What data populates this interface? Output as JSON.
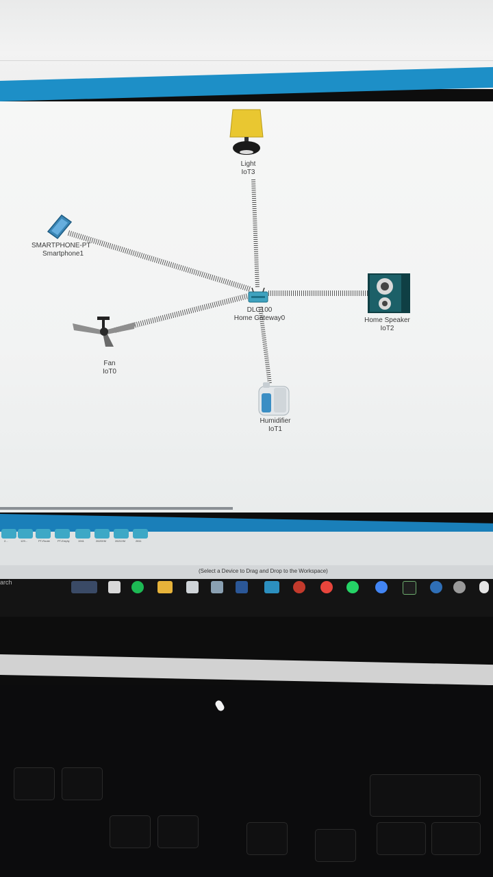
{
  "workspace": {
    "devices": [
      {
        "name": "Light",
        "id": "IoT3"
      },
      {
        "name": "SMARTPHONE-PT",
        "id": "Smartphone1"
      },
      {
        "name": "DLC100",
        "id": "Home Gateway0"
      },
      {
        "name": "Home Speaker",
        "id": "IoT2"
      },
      {
        "name": "Fan",
        "id": "IoT0"
      },
      {
        "name": "Humidifier",
        "id": "IoT1"
      }
    ]
  },
  "device_palette": {
    "labels": [
      "2...",
      "129...",
      "PT-Route",
      "PT-Empty",
      "1941",
      "2620XM",
      "2621XM",
      "2811"
    ]
  },
  "status_hint": "(Select a Device to Drag and Drop to the Workspace)",
  "taskbar": {
    "search_label": "arch"
  },
  "colors": {
    "accent_blue": "#1d8fc7",
    "workspace_bg": "#f3f4f4",
    "link_color": "#555555"
  },
  "icons": [
    "lamp-icon",
    "smartphone-icon",
    "gateway-icon",
    "speaker-icon",
    "ceiling-fan-icon",
    "humidifier-icon"
  ]
}
